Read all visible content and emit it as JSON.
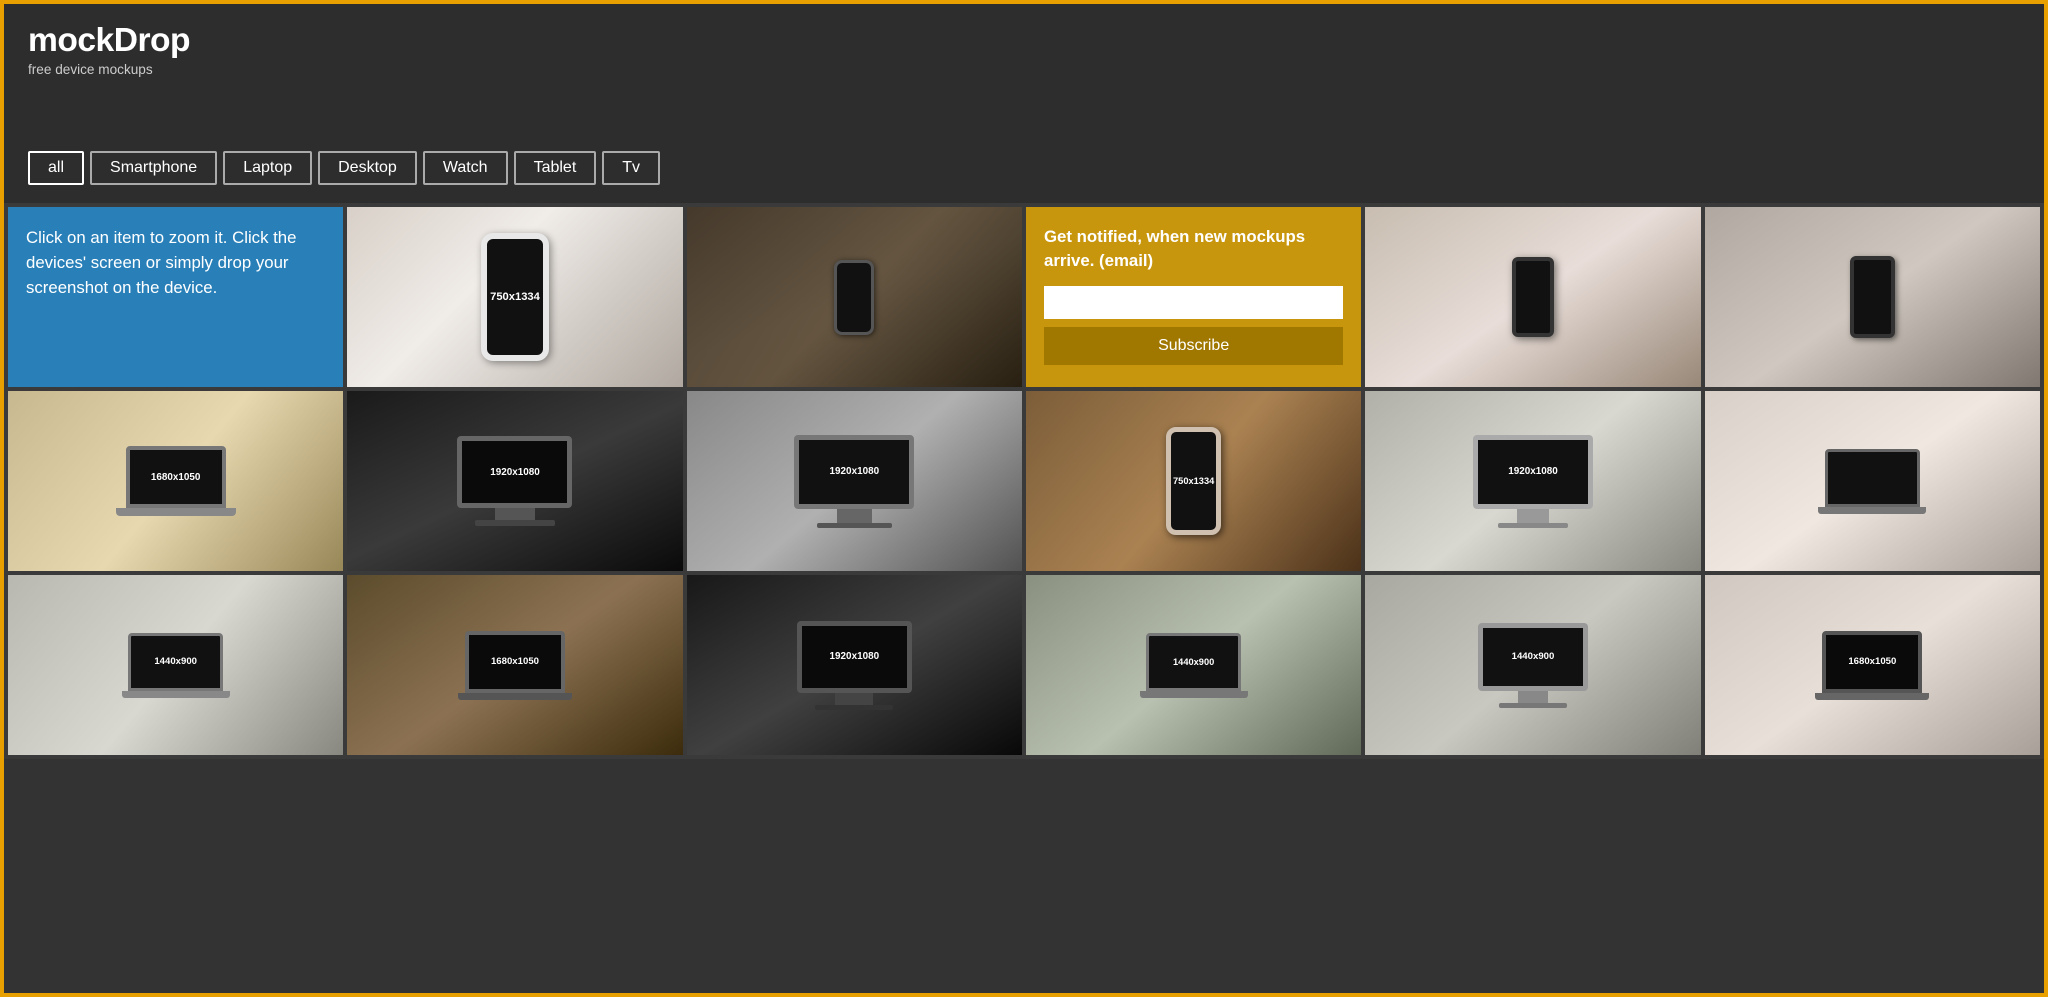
{
  "header": {
    "title": "mockDrop",
    "subtitle": "free device mockups"
  },
  "filters": {
    "buttons": [
      {
        "id": "all",
        "label": "all",
        "active": true
      },
      {
        "id": "smartphone",
        "label": "Smartphone",
        "active": false
      },
      {
        "id": "laptop",
        "label": "Laptop",
        "active": false
      },
      {
        "id": "desktop",
        "label": "Desktop",
        "active": false
      },
      {
        "id": "watch",
        "label": "Watch",
        "active": false
      },
      {
        "id": "tablet",
        "label": "Tablet",
        "active": false
      },
      {
        "id": "tv",
        "label": "Tv",
        "active": false
      }
    ]
  },
  "grid": {
    "info_cell": {
      "text": "Click on an item to zoom it. Click the devices' screen or simply drop your screenshot on the device."
    },
    "notify_cell": {
      "heading": "Get notified, when new mockups arrive. (email)",
      "placeholder": "",
      "button_label": "Subscribe"
    },
    "items": [
      {
        "id": "phone-white-hand",
        "resolution": "750x1334",
        "row": 1
      },
      {
        "id": "person-phone-desk",
        "resolution": "",
        "row": 1
      },
      {
        "id": "person-vr-phone",
        "resolution": "",
        "row": 1
      },
      {
        "id": "tablet-hand",
        "resolution": "",
        "row": 1
      },
      {
        "id": "laptop-desk1",
        "resolution": "1680x1050",
        "row": 2
      },
      {
        "id": "monitor-dark1",
        "resolution": "1920x1080",
        "row": 2
      },
      {
        "id": "mac-desk1",
        "resolution": "1920x1080",
        "row": 2
      },
      {
        "id": "phone-table",
        "resolution": "750x1334",
        "row": 2
      },
      {
        "id": "imac-office1",
        "resolution": "1920x1080",
        "row": 2
      },
      {
        "id": "person-laptop1",
        "resolution": "",
        "row": 2
      },
      {
        "id": "laptop-notebook",
        "resolution": "1440x900",
        "row": 3
      },
      {
        "id": "laptop-couch",
        "resolution": "1680x1050",
        "row": 3
      },
      {
        "id": "monitor-dark2",
        "resolution": "1920x1080",
        "row": 3
      },
      {
        "id": "mac-desk2",
        "resolution": "1440x900",
        "row": 3
      },
      {
        "id": "imac-desk2",
        "resolution": "1440x900",
        "row": 3
      },
      {
        "id": "person-laptop2",
        "resolution": "1680x1050",
        "row": 3
      }
    ]
  }
}
